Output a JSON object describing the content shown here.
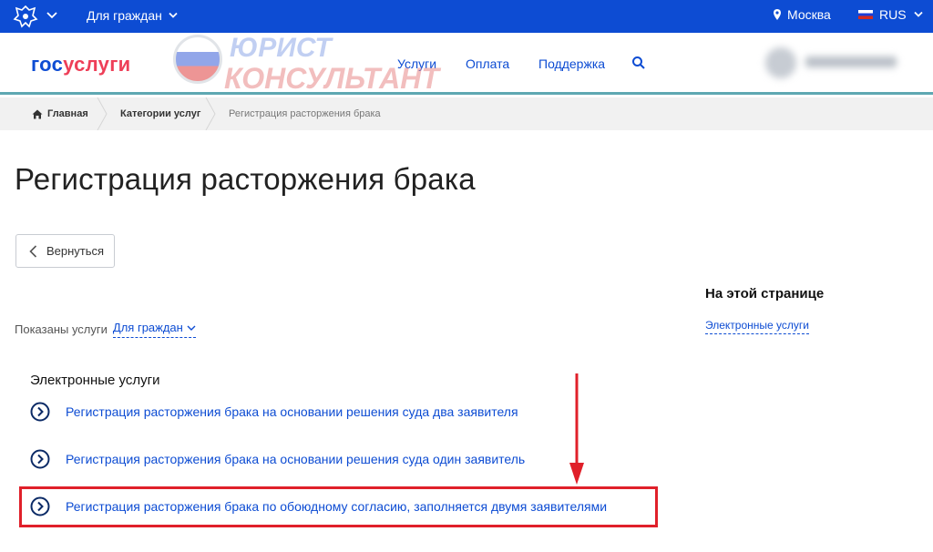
{
  "topbar": {
    "audience": "Для граждан",
    "city": "Москва",
    "language": "RUS"
  },
  "header": {
    "logo_part1": "гос",
    "logo_part2": "услуги",
    "nav": [
      "Услуги",
      "Оплата",
      "Поддержка"
    ]
  },
  "watermark": {
    "line1": "ЮРИСТ",
    "line2": "КОНСУЛЬТАНТ"
  },
  "breadcrumb": {
    "home": "Главная",
    "category": "Категории услуг",
    "current": "Регистрация расторжения брака"
  },
  "page": {
    "title": "Регистрация расторжения брака",
    "back_label": "Вернуться",
    "shown_label": "Показаны услуги",
    "shown_value": "Для граждан"
  },
  "aside": {
    "title": "На этой странице",
    "link": "Электронные услуги"
  },
  "services": {
    "section_title": "Электронные услуги",
    "items": [
      "Регистрация расторжения брака на основании решения суда два заявителя",
      "Регистрация расторжения брака на основании решения суда один заявитель",
      "Регистрация расторжения брака по обоюдному согласию, заполняется двумя заявителями"
    ]
  },
  "colors": {
    "topbar": "#0d4cd3",
    "link": "#0d4cd3",
    "logo_accent": "#ee3f58",
    "highlight": "#e0202a"
  }
}
